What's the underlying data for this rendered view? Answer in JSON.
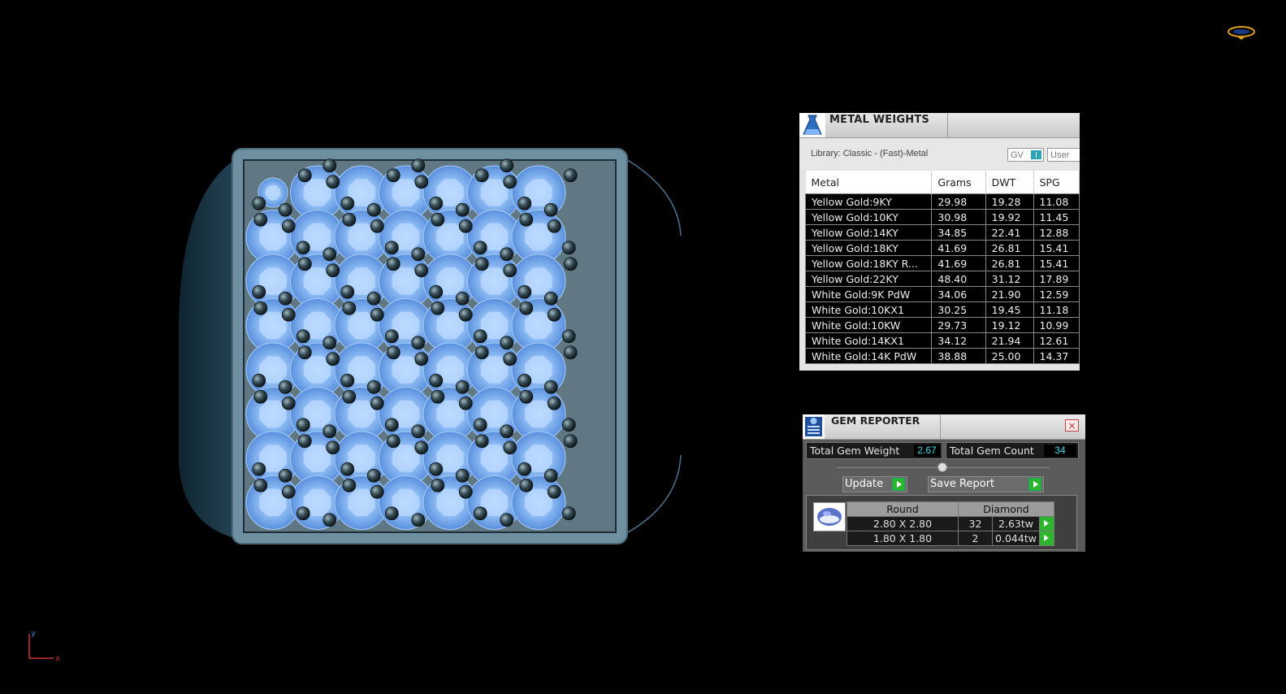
{
  "metal_weights": {
    "title": "METAL WEIGHTS",
    "library": "Library: Classic - (Fast)-Metal",
    "toggle_gv": "GV",
    "toggle_user": "User",
    "columns": [
      "Metal",
      "Grams",
      "DWT",
      "SPG"
    ],
    "rows": [
      [
        "Yellow Gold:9KY",
        "29.98",
        "19.28",
        "11.08"
      ],
      [
        "Yellow Gold:10KY",
        "30.98",
        "19.92",
        "11.45"
      ],
      [
        "Yellow Gold:14KY",
        "34.85",
        "22.41",
        "12.88"
      ],
      [
        "Yellow Gold:18KY",
        "41.69",
        "26.81",
        "15.41"
      ],
      [
        "Yellow Gold:18KY R...",
        "41.69",
        "26.81",
        "15.41"
      ],
      [
        "Yellow Gold:22KY",
        "48.40",
        "31.12",
        "17.89"
      ],
      [
        "White Gold:9K PdW",
        "34.06",
        "21.90",
        "12.59"
      ],
      [
        "White Gold:10KX1",
        "30.25",
        "19.45",
        "11.18"
      ],
      [
        "White Gold:10KW",
        "29.73",
        "19.12",
        "10.99"
      ],
      [
        "White Gold:14KX1",
        "34.12",
        "21.94",
        "12.61"
      ],
      [
        "White Gold:14K PdW",
        "38.88",
        "25.00",
        "14.37"
      ]
    ]
  },
  "gem_reporter": {
    "title": "GEM REPORTER",
    "close_label": "×",
    "total_weight_label": "Total Gem Weight",
    "total_weight_value": "2.67",
    "total_count_label": "Total Gem Count",
    "total_count_value": "34",
    "update_label": "Update",
    "save_label": "Save Report",
    "columns": [
      "Round",
      "Diamond"
    ],
    "rows": [
      [
        "2.80 X 2.80",
        "32",
        "2.63tw"
      ],
      [
        "1.80 X 1.80",
        "2",
        "0.044tw"
      ]
    ]
  },
  "axis": {
    "y": "y",
    "x": "x"
  },
  "icons": {
    "brand": "ring-logo-icon",
    "metal": "metal-flask-icon",
    "gem": "gem-report-icon",
    "gem_shape": "round-gem-icon"
  },
  "colors": {
    "background": "#000000",
    "gem": "#7aaef0",
    "metal_frame": "#6d8c9c",
    "accent": "#2db52d",
    "value_text": "#40d8e8"
  }
}
